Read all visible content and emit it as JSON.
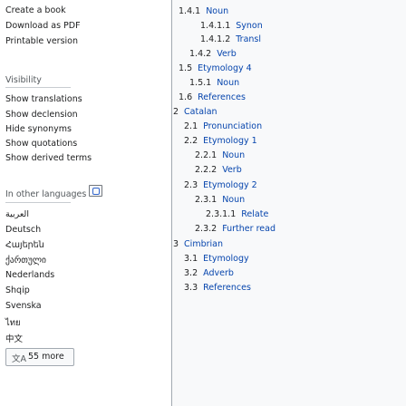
{
  "sidebar": {
    "print": [
      "Create a book",
      "Download as PDF",
      "Printable version"
    ],
    "visibility_heading": "Visibility",
    "visibility": [
      "Show translations",
      "Show declension",
      "Hide synonyms",
      "Show quotations",
      "Show derived terms"
    ],
    "languages_heading": "In other languages",
    "languages": [
      "العربية",
      "Deutsch",
      "Հայերեն",
      "ქართული",
      "Nederlands",
      "Shqip",
      "Svenska",
      "ไทย",
      "中文"
    ],
    "more_label": "55 more",
    "more_icon_glyph": "文A"
  },
  "toc": {
    "items": [
      {
        "num": "1.4.1",
        "text": "Noun"
      },
      {
        "num": "1.4.1.1",
        "text": "Synon"
      },
      {
        "num": "1.4.1.2",
        "text": "Transl"
      },
      {
        "num": "1.4.2",
        "text": "Verb"
      },
      {
        "num": "1.5",
        "text": "Etymology 4"
      },
      {
        "num": "1.5.1",
        "text": "Noun"
      },
      {
        "num": "1.6",
        "text": "References"
      },
      {
        "num": "2",
        "text": "Catalan"
      },
      {
        "num": "2.1",
        "text": "Pronunciation"
      },
      {
        "num": "2.2",
        "text": "Etymology 1"
      },
      {
        "num": "2.2.1",
        "text": "Noun"
      },
      {
        "num": "2.2.2",
        "text": "Verb"
      },
      {
        "num": "2.3",
        "text": "Etymology 2"
      },
      {
        "num": "2.3.1",
        "text": "Noun"
      },
      {
        "num": "2.3.1.1",
        "text": "Relate"
      },
      {
        "num": "2.3.2",
        "text": "Further read"
      },
      {
        "num": "3",
        "text": "Cimbrian"
      },
      {
        "num": "3.1",
        "text": "Etymology"
      },
      {
        "num": "3.2",
        "text": "Adverb"
      },
      {
        "num": "3.3",
        "text": "References"
      }
    ]
  }
}
